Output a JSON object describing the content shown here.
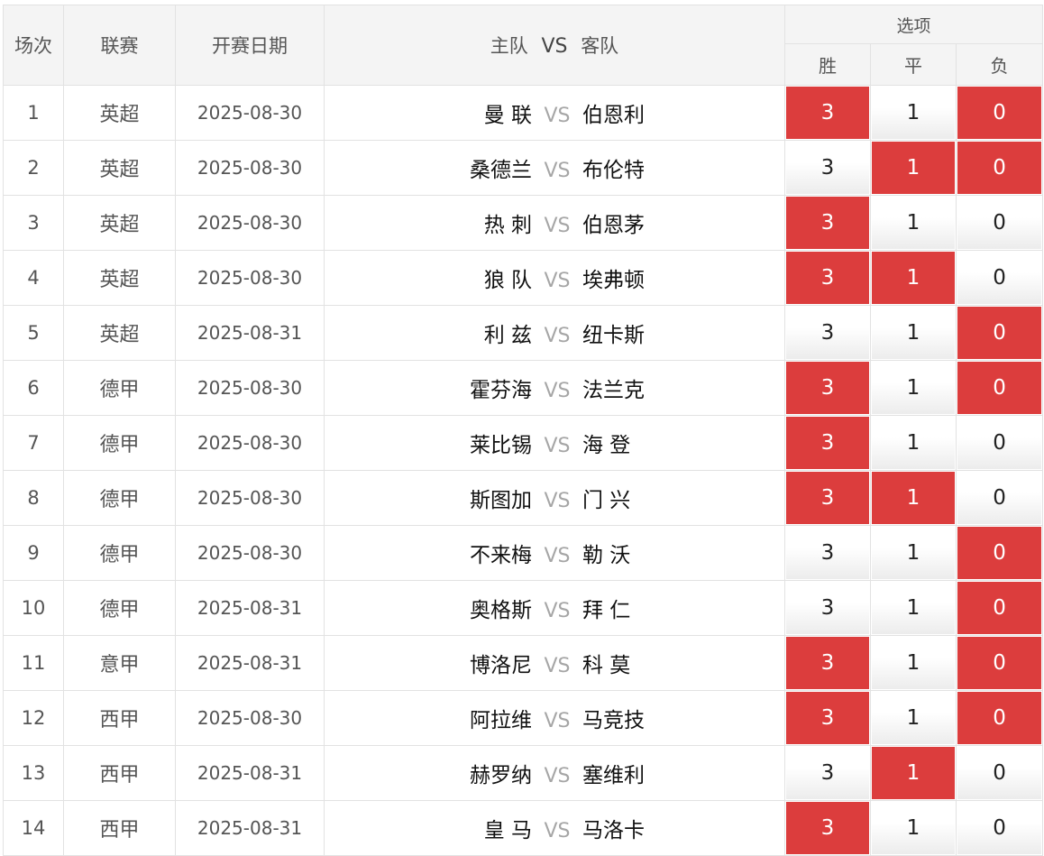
{
  "header": {
    "col_index": "场次",
    "col_league": "联赛",
    "col_date": "开赛日期",
    "col_home": "主队",
    "col_vs": "VS",
    "col_away": "客队",
    "col_options": "选项",
    "col_win": "胜",
    "col_draw": "平",
    "col_loss": "负"
  },
  "colors": {
    "selected": "#dc3d3d",
    "vs_text": "#a6a6a6"
  },
  "rows": [
    {
      "no": "1",
      "league": "英超",
      "date": "2025-08-30",
      "home": "曼 联",
      "vs": "VS",
      "away": "伯恩利",
      "win": "3",
      "draw": "1",
      "loss": "0",
      "sel_win": true,
      "sel_draw": false,
      "sel_loss": true
    },
    {
      "no": "2",
      "league": "英超",
      "date": "2025-08-30",
      "home": "桑德兰",
      "vs": "VS",
      "away": "布伦特",
      "win": "3",
      "draw": "1",
      "loss": "0",
      "sel_win": false,
      "sel_draw": true,
      "sel_loss": true
    },
    {
      "no": "3",
      "league": "英超",
      "date": "2025-08-30",
      "home": "热 刺",
      "vs": "VS",
      "away": "伯恩茅",
      "win": "3",
      "draw": "1",
      "loss": "0",
      "sel_win": true,
      "sel_draw": false,
      "sel_loss": false
    },
    {
      "no": "4",
      "league": "英超",
      "date": "2025-08-30",
      "home": "狼 队",
      "vs": "VS",
      "away": "埃弗顿",
      "win": "3",
      "draw": "1",
      "loss": "0",
      "sel_win": true,
      "sel_draw": true,
      "sel_loss": false
    },
    {
      "no": "5",
      "league": "英超",
      "date": "2025-08-31",
      "home": "利 兹",
      "vs": "VS",
      "away": "纽卡斯",
      "win": "3",
      "draw": "1",
      "loss": "0",
      "sel_win": false,
      "sel_draw": false,
      "sel_loss": true
    },
    {
      "no": "6",
      "league": "德甲",
      "date": "2025-08-30",
      "home": "霍芬海",
      "vs": "VS",
      "away": "法兰克",
      "win": "3",
      "draw": "1",
      "loss": "0",
      "sel_win": true,
      "sel_draw": false,
      "sel_loss": true
    },
    {
      "no": "7",
      "league": "德甲",
      "date": "2025-08-30",
      "home": "莱比锡",
      "vs": "VS",
      "away": "海 登",
      "win": "3",
      "draw": "1",
      "loss": "0",
      "sel_win": true,
      "sel_draw": false,
      "sel_loss": false
    },
    {
      "no": "8",
      "league": "德甲",
      "date": "2025-08-30",
      "home": "斯图加",
      "vs": "VS",
      "away": "门 兴",
      "win": "3",
      "draw": "1",
      "loss": "0",
      "sel_win": true,
      "sel_draw": true,
      "sel_loss": false
    },
    {
      "no": "9",
      "league": "德甲",
      "date": "2025-08-30",
      "home": "不来梅",
      "vs": "VS",
      "away": "勒 沃",
      "win": "3",
      "draw": "1",
      "loss": "0",
      "sel_win": false,
      "sel_draw": false,
      "sel_loss": true
    },
    {
      "no": "10",
      "league": "德甲",
      "date": "2025-08-31",
      "home": "奥格斯",
      "vs": "VS",
      "away": "拜 仁",
      "win": "3",
      "draw": "1",
      "loss": "0",
      "sel_win": false,
      "sel_draw": false,
      "sel_loss": true
    },
    {
      "no": "11",
      "league": "意甲",
      "date": "2025-08-31",
      "home": "博洛尼",
      "vs": "VS",
      "away": "科 莫",
      "win": "3",
      "draw": "1",
      "loss": "0",
      "sel_win": true,
      "sel_draw": false,
      "sel_loss": true
    },
    {
      "no": "12",
      "league": "西甲",
      "date": "2025-08-30",
      "home": "阿拉维",
      "vs": "VS",
      "away": "马竞技",
      "win": "3",
      "draw": "1",
      "loss": "0",
      "sel_win": true,
      "sel_draw": false,
      "sel_loss": true
    },
    {
      "no": "13",
      "league": "西甲",
      "date": "2025-08-31",
      "home": "赫罗纳",
      "vs": "VS",
      "away": "塞维利",
      "win": "3",
      "draw": "1",
      "loss": "0",
      "sel_win": false,
      "sel_draw": true,
      "sel_loss": false
    },
    {
      "no": "14",
      "league": "西甲",
      "date": "2025-08-31",
      "home": "皇 马",
      "vs": "VS",
      "away": "马洛卡",
      "win": "3",
      "draw": "1",
      "loss": "0",
      "sel_win": true,
      "sel_draw": false,
      "sel_loss": false
    }
  ]
}
